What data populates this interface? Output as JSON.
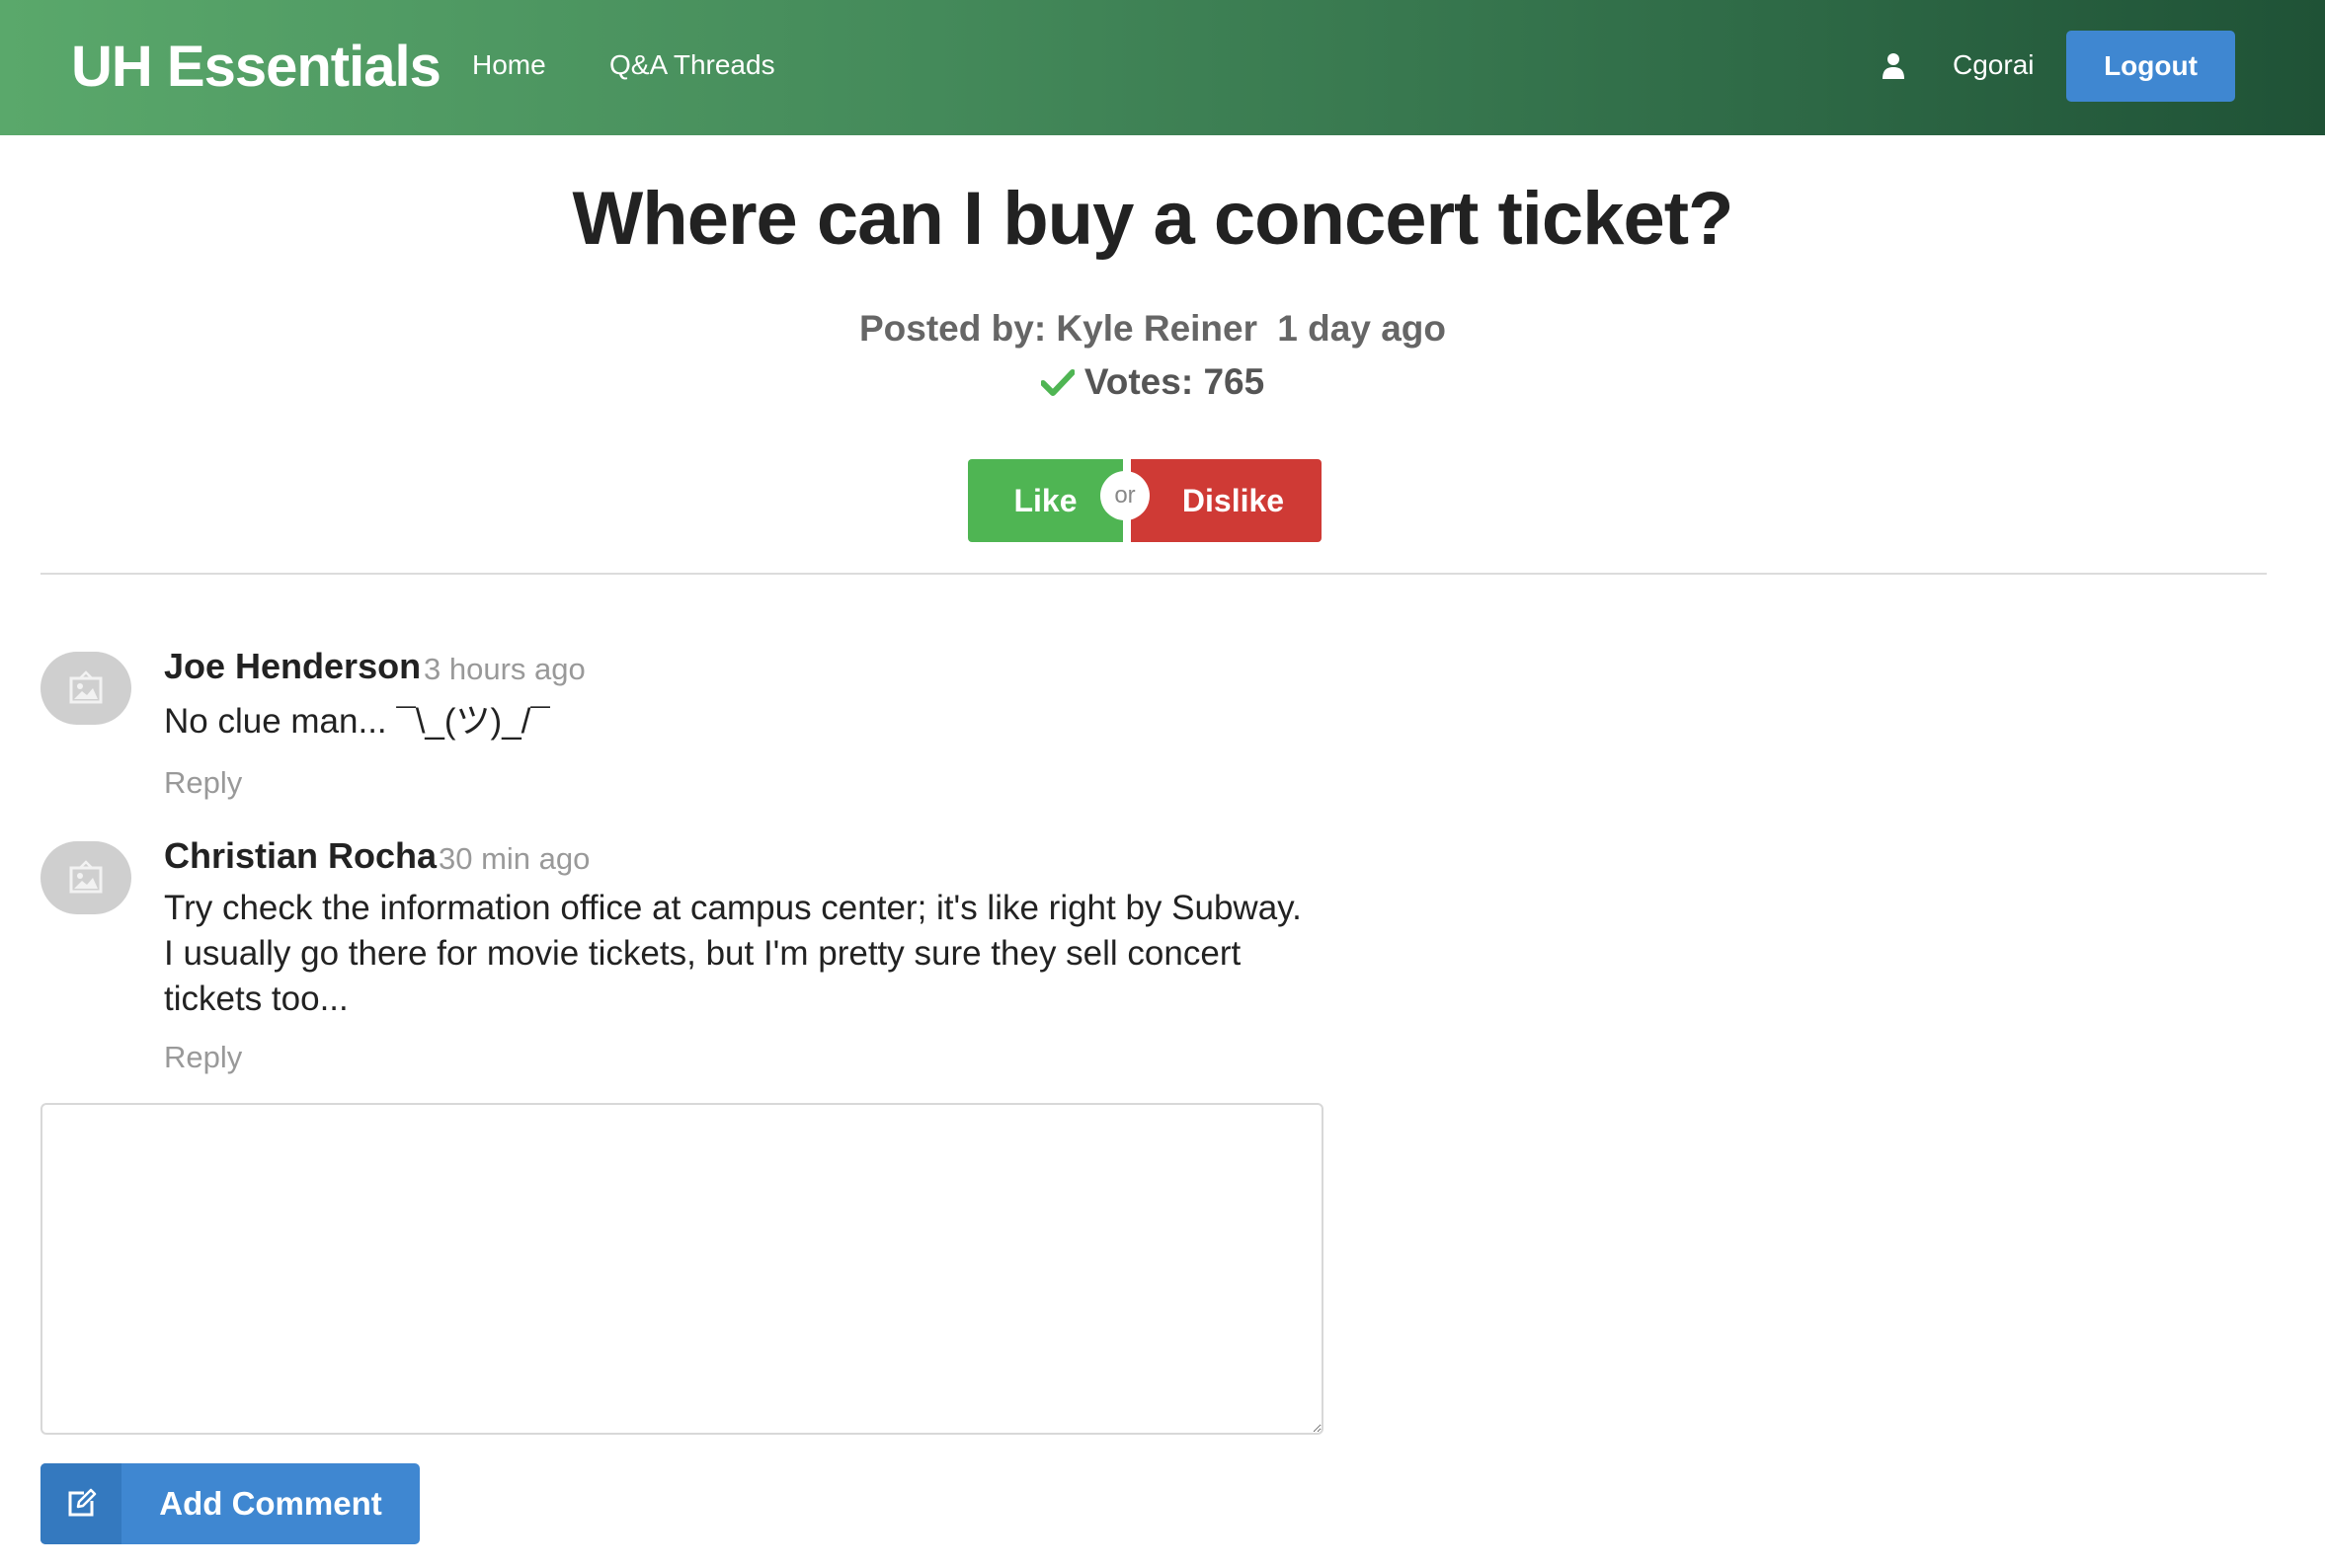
{
  "navbar": {
    "brand": "UH Essentials",
    "links": [
      "Home",
      "Q&A Threads"
    ],
    "username": "Cgorai",
    "logout_label": "Logout",
    "colors": {
      "gradient_start": "#5aa86b",
      "gradient_end": "#1f5236",
      "logout": "#3f87d1"
    }
  },
  "thread": {
    "title": "Where can I buy a concert ticket?",
    "posted_by_label": "Posted by:",
    "author": "Kyle Reiner",
    "time": "1 day ago",
    "votes_label": "Votes:",
    "votes": "765"
  },
  "vote_buttons": {
    "like": "Like",
    "or": "or",
    "dislike": "Dislike",
    "colors": {
      "like": "#4fb553",
      "dislike": "#cf3a35"
    }
  },
  "comments": [
    {
      "author": "Joe Henderson",
      "time": "3 hours ago",
      "lines": [
        "No clue man... ¯\\_(ツ)_/¯"
      ],
      "reply_label": "Reply",
      "avatar_icon": "image-icon"
    },
    {
      "author": "Christian Rocha",
      "time": "30 min ago",
      "lines": [
        "Try check the information office at campus center; it's like right by Subway.",
        "I usually go there for movie tickets, but I'm pretty sure they sell concert",
        "tickets too..."
      ],
      "reply_label": "Reply",
      "avatar_icon": "image-icon"
    }
  ],
  "comment_form": {
    "value": "",
    "placeholder": "",
    "submit_label": "Add Comment",
    "submit_icon": "edit-icon"
  }
}
